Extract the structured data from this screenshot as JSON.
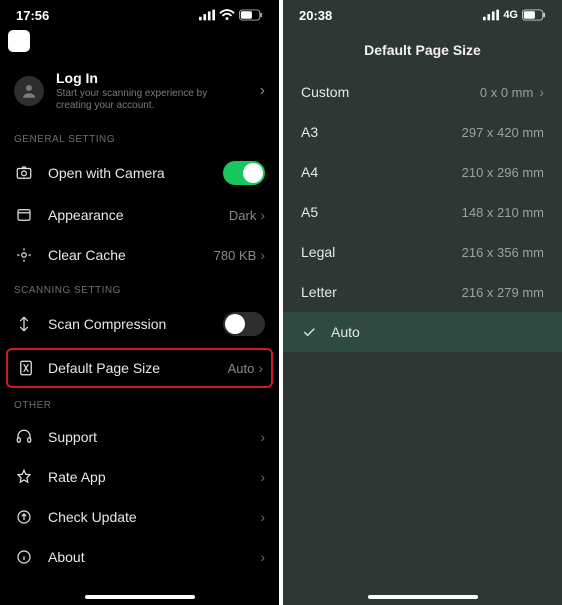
{
  "left": {
    "status": {
      "time": "17:56"
    },
    "login": {
      "title": "Log In",
      "sub": "Start your scanning experience by creating your account."
    },
    "sections": {
      "general": {
        "header": "GENERAL SETTING",
        "open_camera": {
          "label": "Open with Camera",
          "on": true
        },
        "appearance": {
          "label": "Appearance",
          "value": "Dark"
        },
        "clear_cache": {
          "label": "Clear Cache",
          "value": "780 KB"
        }
      },
      "scanning": {
        "header": "SCANNING SETTING",
        "scan_compression": {
          "label": "Scan Compression",
          "on": false
        },
        "default_page_size": {
          "label": "Default Page Size",
          "value": "Auto"
        }
      },
      "other": {
        "header": "OTHER",
        "support": {
          "label": "Support"
        },
        "rate": {
          "label": "Rate App"
        },
        "update": {
          "label": "Check Update"
        },
        "about": {
          "label": "About"
        }
      }
    }
  },
  "right": {
    "status": {
      "time": "20:38",
      "network": "4G"
    },
    "title": "Default Page Size",
    "options": {
      "custom": {
        "name": "Custom",
        "dim": "0 x 0 mm"
      },
      "a3": {
        "name": "A3",
        "dim": "297 x 420 mm"
      },
      "a4": {
        "name": "A4",
        "dim": "210 x 296 mm"
      },
      "a5": {
        "name": "A5",
        "dim": "148 x 210 mm"
      },
      "legal": {
        "name": "Legal",
        "dim": "216 x 356 mm"
      },
      "letter": {
        "name": "Letter",
        "dim": "216 x 279 mm"
      },
      "auto": {
        "name": "Auto"
      }
    }
  }
}
